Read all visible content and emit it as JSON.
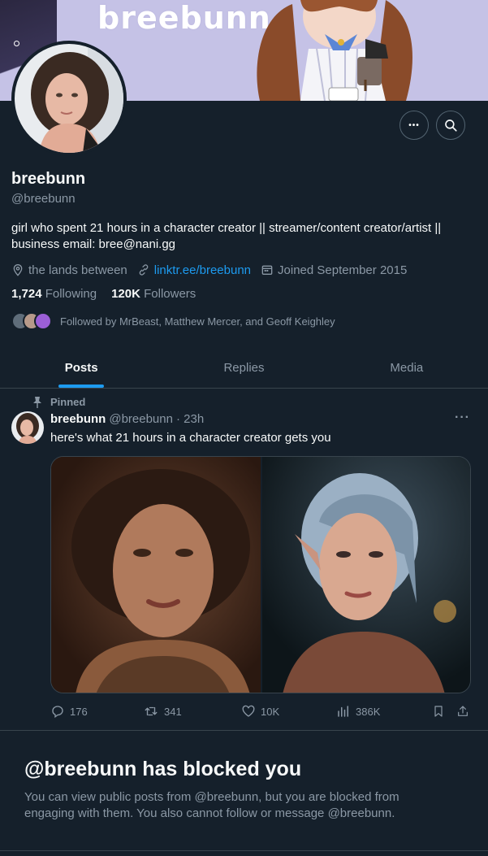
{
  "banner": {
    "logo_text": "breebunn"
  },
  "profile": {
    "name": "breebunn",
    "handle": "@breebunn",
    "bio": "girl who spent 21 hours in a character creator || streamer/content creator/artist || business email: bree@nani.gg",
    "location": "the lands between",
    "link": "linktr.ee/breebunn",
    "joined": "Joined September 2015",
    "following_count": "1,724",
    "following_label": "Following",
    "followers_count": "120K",
    "followers_label": "Followers",
    "followed_by": "Followed by MrBeast, Matthew Mercer, and Geoff Keighley"
  },
  "header_actions": {
    "more_label": "•••"
  },
  "tabs": [
    {
      "label": "Posts",
      "active": true
    },
    {
      "label": "Replies",
      "active": false
    },
    {
      "label": "Media",
      "active": false
    }
  ],
  "tweet": {
    "pinned_label": "Pinned",
    "author_name": "breebunn",
    "author_handle": "@breebunn",
    "time": "· 23h",
    "more_label": "···",
    "text": "here's what 21 hours in a character creator gets you",
    "replies": "176",
    "retweets": "341",
    "likes": "10K",
    "views": "386K"
  },
  "blocked": {
    "title": "@breebunn has blocked you",
    "body": "You can view public posts from @breebunn, but you are blocked from engaging with them. You also cannot follow or message @breebunn."
  },
  "colors": {
    "background": "#15202b",
    "accent": "#1d9bf0",
    "muted_text": "#8b98a5",
    "border": "#38444d",
    "banner": "#c5c2e6"
  }
}
